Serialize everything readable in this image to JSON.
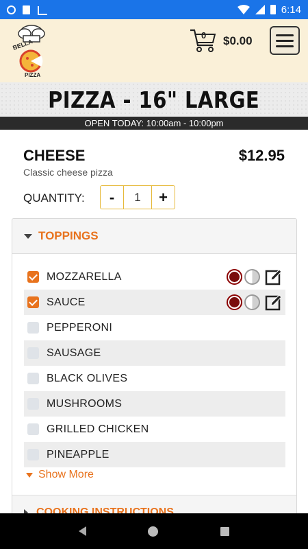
{
  "status_bar": {
    "time": "6:14",
    "background": "#1a74e8"
  },
  "header": {
    "logo_text": "BELLA PIZZA",
    "cart_count": "0",
    "cart_total": "$0.00",
    "menu_icon": "hamburger-icon"
  },
  "page": {
    "title": "PIZZA - 16\" LARGE",
    "hours": "OPEN TODAY: 10:00am - 10:00pm"
  },
  "product": {
    "name": "CHEESE",
    "price": "$12.95",
    "description": "Classic cheese pizza",
    "quantity_label": "QUANTITY:",
    "quantity_value": "1",
    "minus_label": "-",
    "plus_label": "+"
  },
  "toppings_section": {
    "label": "TOPPINGS",
    "items": [
      {
        "name": "MOZZARELLA",
        "checked": true
      },
      {
        "name": "SAUCE",
        "checked": true
      },
      {
        "name": "PEPPERONI",
        "checked": false
      },
      {
        "name": "SAUSAGE",
        "checked": false
      },
      {
        "name": "BLACK OLIVES",
        "checked": false
      },
      {
        "name": "MUSHROOMS",
        "checked": false
      },
      {
        "name": "GRILLED CHICKEN",
        "checked": false
      },
      {
        "name": "PINEAPPLE",
        "checked": false
      }
    ],
    "show_more": "Show More"
  },
  "cooking_section": {
    "label": "COOKING INSTRUCTIONS"
  },
  "colors": {
    "accent": "#e8731e",
    "header_bg": "#faf0d8",
    "checked": "#e8731e"
  }
}
